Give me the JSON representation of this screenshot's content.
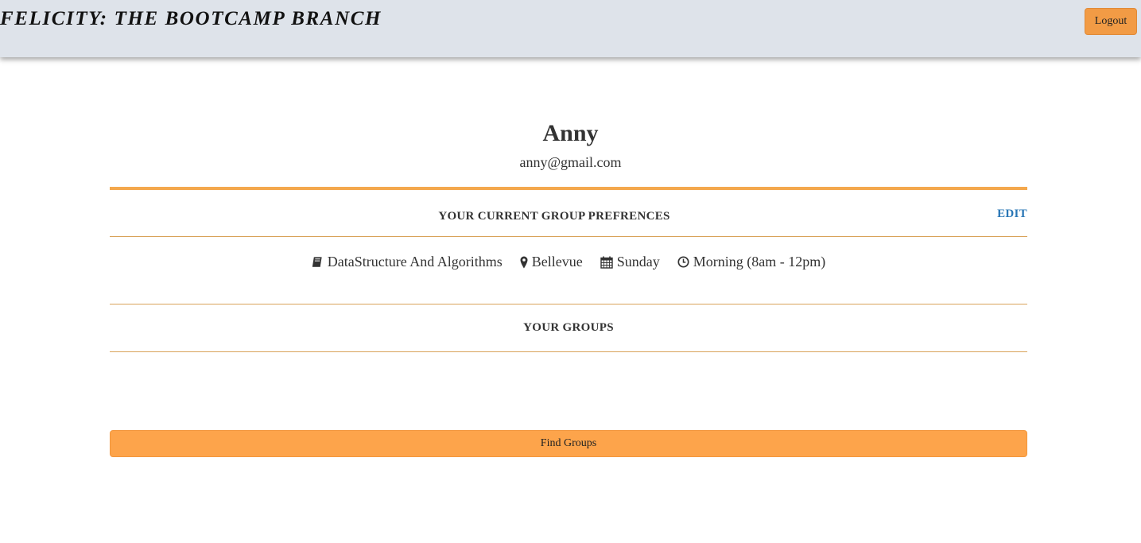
{
  "navbar": {
    "brand": "FELICITY: THE BOOTCAMP BRANCH",
    "logout_label": "Logout"
  },
  "profile": {
    "name": "Anny",
    "email": "anny@gmail.com"
  },
  "preferences": {
    "title": "YOUR CURRENT GROUP PREFRENCES",
    "edit_label": "EDIT",
    "items": [
      {
        "icon": "book-icon",
        "label": "DataStructure And Algorithms"
      },
      {
        "icon": "map-marker-icon",
        "label": "Bellevue"
      },
      {
        "icon": "calendar-icon",
        "label": "Sunday"
      },
      {
        "icon": "clock-icon",
        "label": "Morning (8am - 12pm)"
      }
    ]
  },
  "groups": {
    "title": "YOUR GROUPS",
    "items": []
  },
  "actions": {
    "find_groups_label": "Find Groups"
  },
  "colors": {
    "navbar_bg": "#dee3ea",
    "accent_orange": "#fda44b",
    "rule_orange": "#f4a84d",
    "link_blue": "#2a77b6"
  }
}
